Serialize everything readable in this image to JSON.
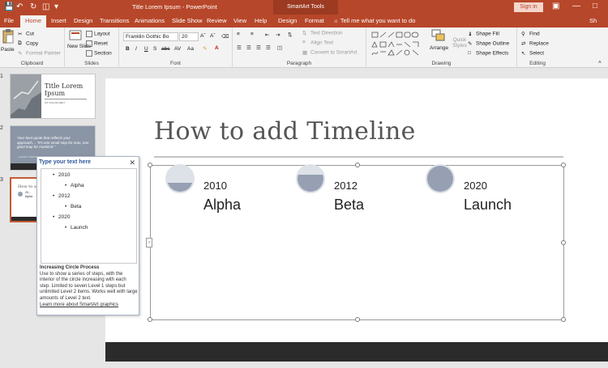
{
  "window": {
    "doc_title": "Title Lorem Ipsum  -  PowerPoint",
    "context_title": "SmartArt Tools",
    "sign_in": "Sign in"
  },
  "ribbon_tabs": [
    "File",
    "Home",
    "Insert",
    "Design",
    "Transitions",
    "Animations",
    "Slide Show",
    "Review",
    "View",
    "Help",
    "Design",
    "Format"
  ],
  "tell_me": "Tell me what you want to do",
  "share": "Sh",
  "clipboard": {
    "paste": "Paste",
    "cut": "Cut",
    "copy": "Copy",
    "format_painter": "Format Painter",
    "label": "Clipboard"
  },
  "slides_group": {
    "new_slide": "New Slide",
    "layout": "Layout",
    "reset": "Reset",
    "section": "Section",
    "label": "Slides"
  },
  "font_group": {
    "font_name": "Franklin Gothic Bo",
    "font_size": "20",
    "label": "Font",
    "bold": "B",
    "italic": "I",
    "underline": "U",
    "strike": "S",
    "shadow": "abc",
    "spacing": "AV",
    "case": "Aa"
  },
  "paragraph_group": {
    "text_direction": "Text Direction",
    "align_text": "Align Text",
    "convert_smartart": "Convert to SmartArt",
    "label": "Paragraph"
  },
  "drawing_group": {
    "arrange": "Arrange",
    "quick_styles": "Quick Styles",
    "shape_fill": "Shape Fill",
    "shape_outline": "Shape Outline",
    "shape_effects": "Shape Effects",
    "label": "Drawing"
  },
  "editing_group": {
    "find": "Find",
    "replace": "Replace",
    "select": "Select",
    "label": "Editing"
  },
  "thumbnails": [
    {
      "number": "1",
      "title": "Title Lorem Ipsum",
      "subtitle": "SIT DOLOR AMET"
    },
    {
      "number": "2",
      "quote": "Your best quote that reflects your approach… \"It's one small step for man, one giant leap for mankind.\"",
      "attribution": "- JOHNNY SMITH, CEO"
    },
    {
      "number": "3",
      "title": "How to add",
      "lines": [
        "20…",
        "Alpha"
      ]
    }
  ],
  "slide": {
    "title": "How to add Timeline",
    "steps": [
      {
        "year": "2010",
        "name": "Alpha",
        "fill": 0.33
      },
      {
        "year": "2012",
        "name": "Beta",
        "fill": 0.66
      },
      {
        "year": "2020",
        "name": "Launch",
        "fill": 1.0
      }
    ]
  },
  "text_pane": {
    "title": "Type your text here",
    "items": [
      {
        "level": 1,
        "text": "2010"
      },
      {
        "level": 2,
        "text": "Alpha"
      },
      {
        "level": 1,
        "text": "2012"
      },
      {
        "level": 2,
        "text": "Beta"
      },
      {
        "level": 1,
        "text": "2020"
      },
      {
        "level": 2,
        "text": "Launch"
      }
    ],
    "desc_title": "Increasing Circle Process",
    "desc": "Use to show a series of steps, with the interior of the circle increasing with each step. Limited to seven Level 1 steps but unlimited Level 2 items. Works well with large amounts of Level 2 text.",
    "link": "Learn more about SmartArt graphics"
  },
  "colors": {
    "accent": "#b7472a",
    "circle_fill": "#96a0b2",
    "circle_ring": "#dde1e8"
  }
}
